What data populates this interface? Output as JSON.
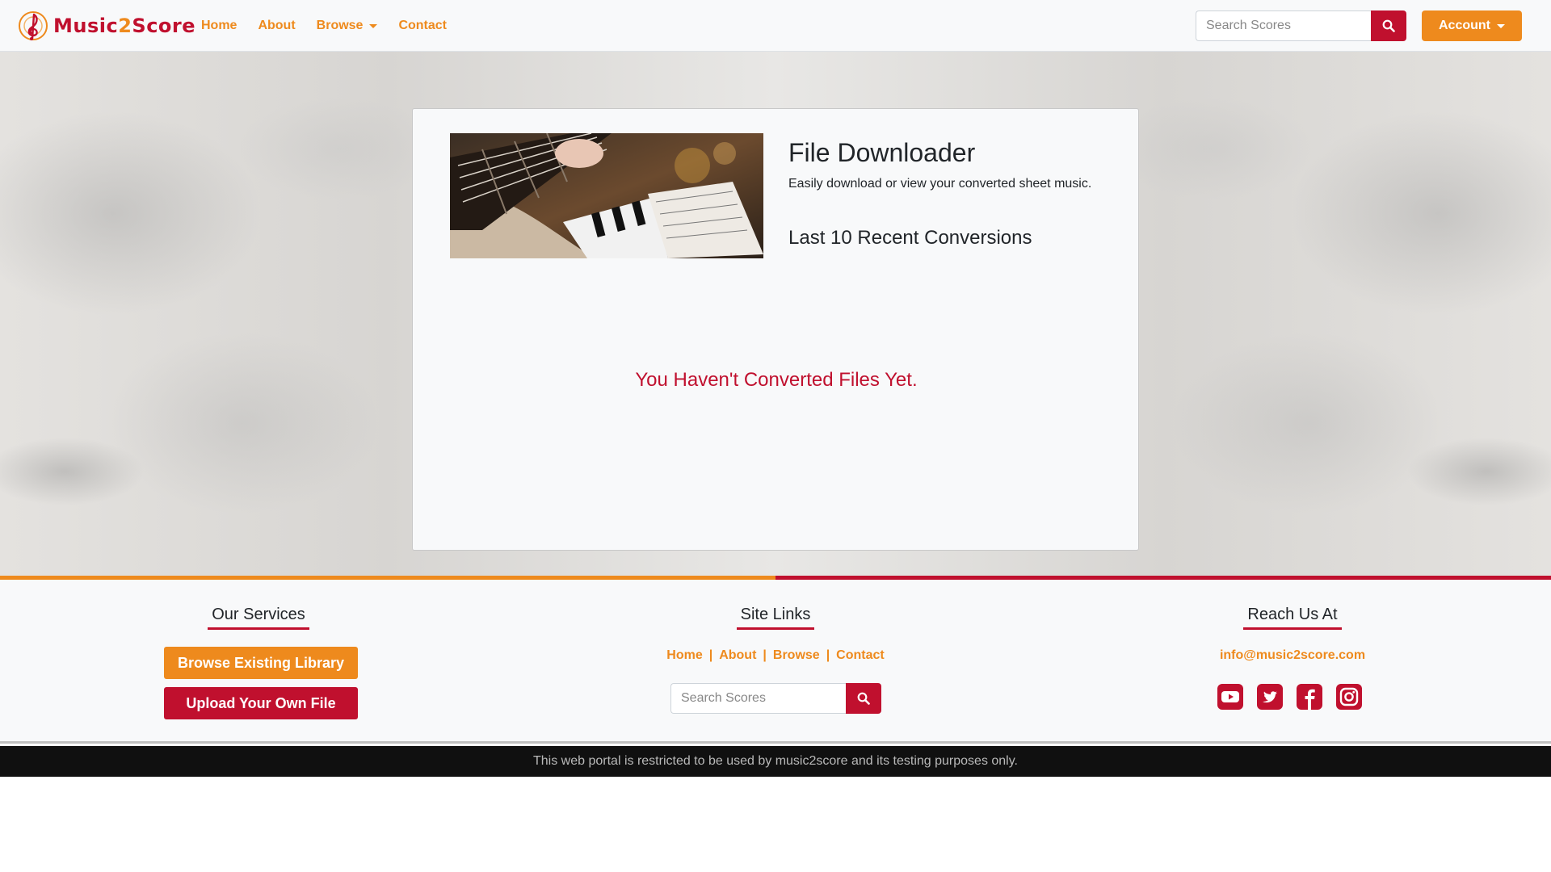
{
  "brand": {
    "name_part1": "Music",
    "name_part2": "2",
    "name_part3": "Score"
  },
  "nav": {
    "items": [
      {
        "label": "Home"
      },
      {
        "label": "About"
      },
      {
        "label": "Browse"
      },
      {
        "label": "Contact"
      }
    ],
    "search_placeholder": "Search Scores",
    "account_label": "Account"
  },
  "card": {
    "title": "File Downloader",
    "subtitle": "Easily download or view your converted sheet music.",
    "recent_heading": "Last 10 Recent Conversions",
    "empty_message": "You Haven't Converted Files Yet."
  },
  "footer": {
    "services_title": "Our Services",
    "browse_library_label": "Browse Existing Library",
    "upload_label": "Upload Your Own File",
    "site_links_title": "Site Links",
    "site_links": [
      "Home",
      "About",
      "Browse",
      "Contact"
    ],
    "search_placeholder": "Search Scores",
    "reach_title": "Reach Us At",
    "email": "info@music2score.com",
    "socials": [
      "youtube-icon",
      "twitter-icon",
      "facebook-icon",
      "instagram-icon"
    ]
  },
  "bottom_notice": "This web portal is restricted to be used by music2score and its testing purposes only.",
  "colors": {
    "accent_orange": "#ee8a1d",
    "accent_red": "#c0102e"
  }
}
